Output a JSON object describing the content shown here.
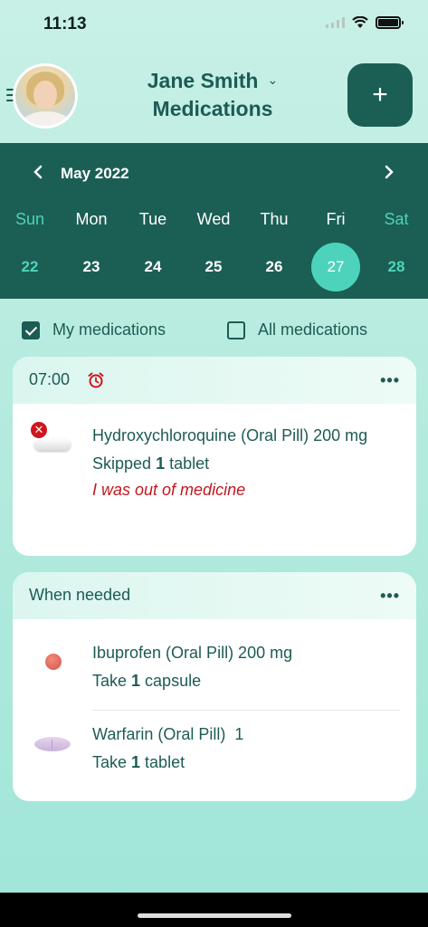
{
  "status_bar": {
    "time": "11:13"
  },
  "header": {
    "user_name": "Jane Smith",
    "title": "Medications",
    "add_label": "+"
  },
  "calendar": {
    "month": "May 2022",
    "prev_label": "‹",
    "next_label": "›",
    "weekdays": [
      "Sun",
      "Mon",
      "Tue",
      "Wed",
      "Thu",
      "Fri",
      "Sat"
    ],
    "days": [
      "22",
      "23",
      "24",
      "25",
      "26",
      "27",
      "28"
    ],
    "selected_day": "27"
  },
  "filters": {
    "my_medications": "My medications",
    "all_medications": "All medications",
    "my_checked": true,
    "all_checked": false
  },
  "schedule_card": {
    "time": "07:00",
    "more_label": "•••",
    "items": [
      {
        "name": "Hydroxychloroquine (Oral Pill) 200 mg",
        "status_prefix": "Skipped ",
        "qty": "1",
        "unit": " tablet",
        "note": "I was out of medicine"
      }
    ]
  },
  "prn_card": {
    "title": "When needed",
    "more_label": "•••",
    "items": [
      {
        "name": "Ibuprofen (Oral Pill) 200 mg",
        "prefix": "Take ",
        "qty": "1",
        "unit": " capsule"
      },
      {
        "name": "Warfarin (Oral Pill)  1",
        "prefix": "Take ",
        "qty": "1",
        "unit": " tablet"
      }
    ]
  },
  "colors": {
    "primary": "#1b5e54",
    "accent": "#4dd3bb",
    "error": "#c0181f"
  }
}
